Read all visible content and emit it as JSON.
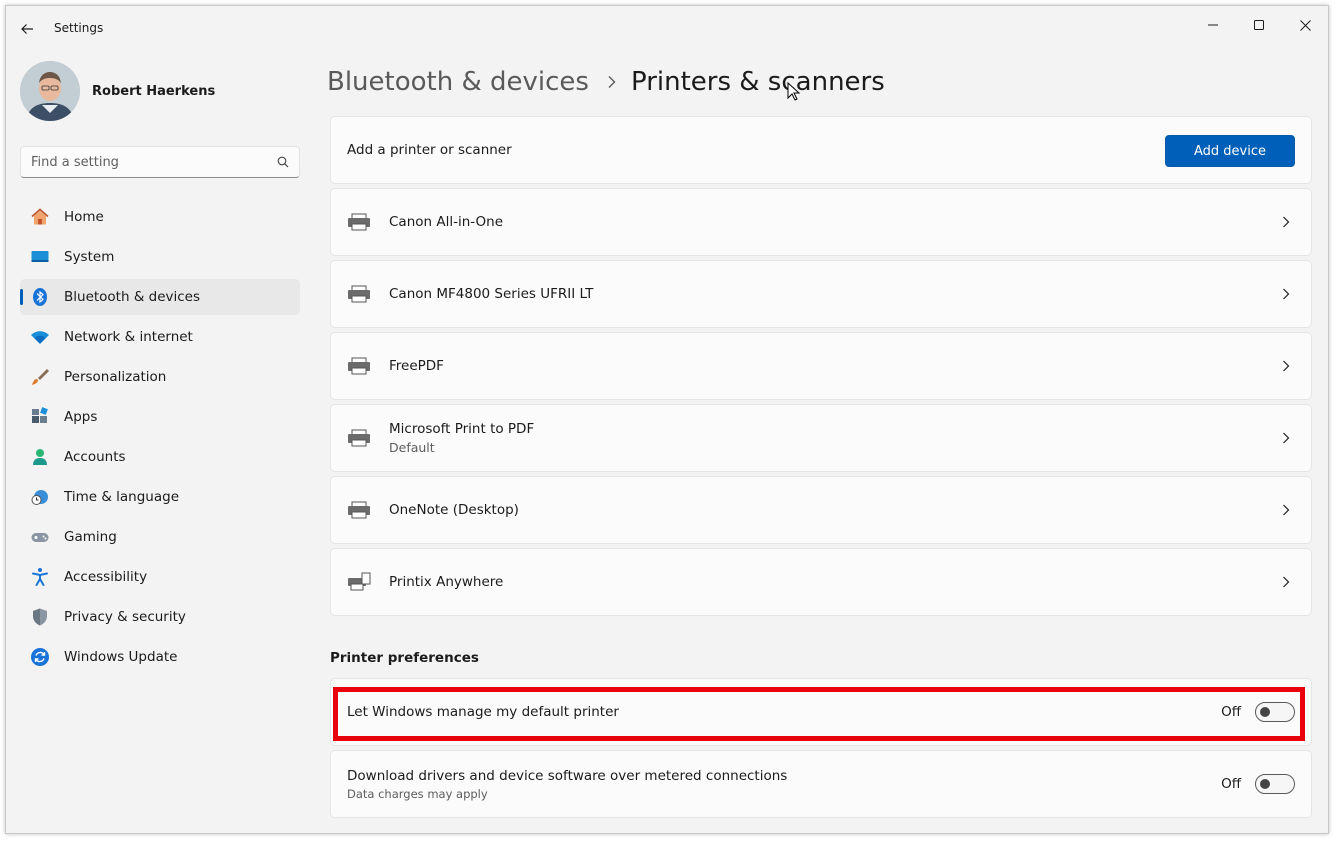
{
  "window": {
    "title": "Settings"
  },
  "profile": {
    "name": "Robert Haerkens"
  },
  "search": {
    "placeholder": "Find a setting"
  },
  "sidebar": {
    "items": [
      {
        "label": "Home"
      },
      {
        "label": "System"
      },
      {
        "label": "Bluetooth & devices"
      },
      {
        "label": "Network & internet"
      },
      {
        "label": "Personalization"
      },
      {
        "label": "Apps"
      },
      {
        "label": "Accounts"
      },
      {
        "label": "Time & language"
      },
      {
        "label": "Gaming"
      },
      {
        "label": "Accessibility"
      },
      {
        "label": "Privacy & security"
      },
      {
        "label": "Windows Update"
      }
    ],
    "active_item": "Bluetooth & devices"
  },
  "breadcrumb": {
    "parent": "Bluetooth & devices",
    "current": "Printers & scanners"
  },
  "add_printer": {
    "label": "Add a printer or scanner",
    "button": "Add device"
  },
  "printers": [
    {
      "name": "Canon All-in-One",
      "sub": ""
    },
    {
      "name": "Canon MF4800 Series UFRII LT",
      "sub": ""
    },
    {
      "name": "FreePDF",
      "sub": ""
    },
    {
      "name": "Microsoft Print to PDF",
      "sub": "Default"
    },
    {
      "name": "OneNote (Desktop)",
      "sub": ""
    },
    {
      "name": "Printix Anywhere",
      "sub": ""
    }
  ],
  "preferences": {
    "title": "Printer preferences",
    "items": [
      {
        "label": "Let Windows manage my default printer",
        "sub": "",
        "state": "Off"
      },
      {
        "label": "Download drivers and device software over metered connections",
        "sub": "Data charges may apply",
        "state": "Off"
      }
    ]
  },
  "colors": {
    "accent": "#005fb8",
    "highlight": "#e8000c"
  }
}
